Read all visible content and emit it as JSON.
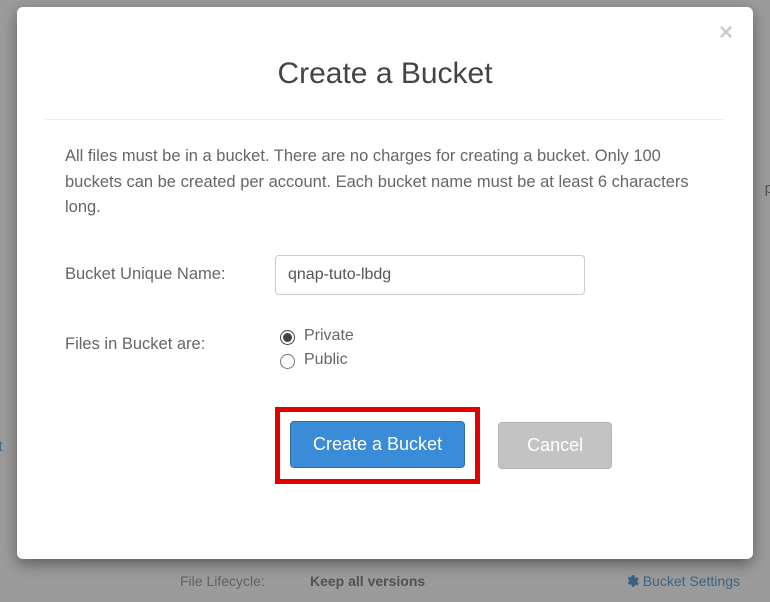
{
  "background": {
    "left_fragment": "nt",
    "right_fragment": "p",
    "row_label": "File Lifecycle:",
    "row_value": "Keep all versions",
    "settings_label": "Bucket Settings"
  },
  "modal": {
    "title": "Create a Bucket",
    "description": "All files must be in a bucket. There are no charges for creating a bucket. Only 100 buckets can be created per account. Each bucket name must be at least 6 characters long.",
    "name_label": "Bucket Unique Name:",
    "name_value": "qnap-tuto-lbdg",
    "privacy_label": "Files in Bucket are:",
    "privacy_options": {
      "private": "Private",
      "public": "Public"
    },
    "create_button": "Create a Bucket",
    "cancel_button": "Cancel"
  }
}
